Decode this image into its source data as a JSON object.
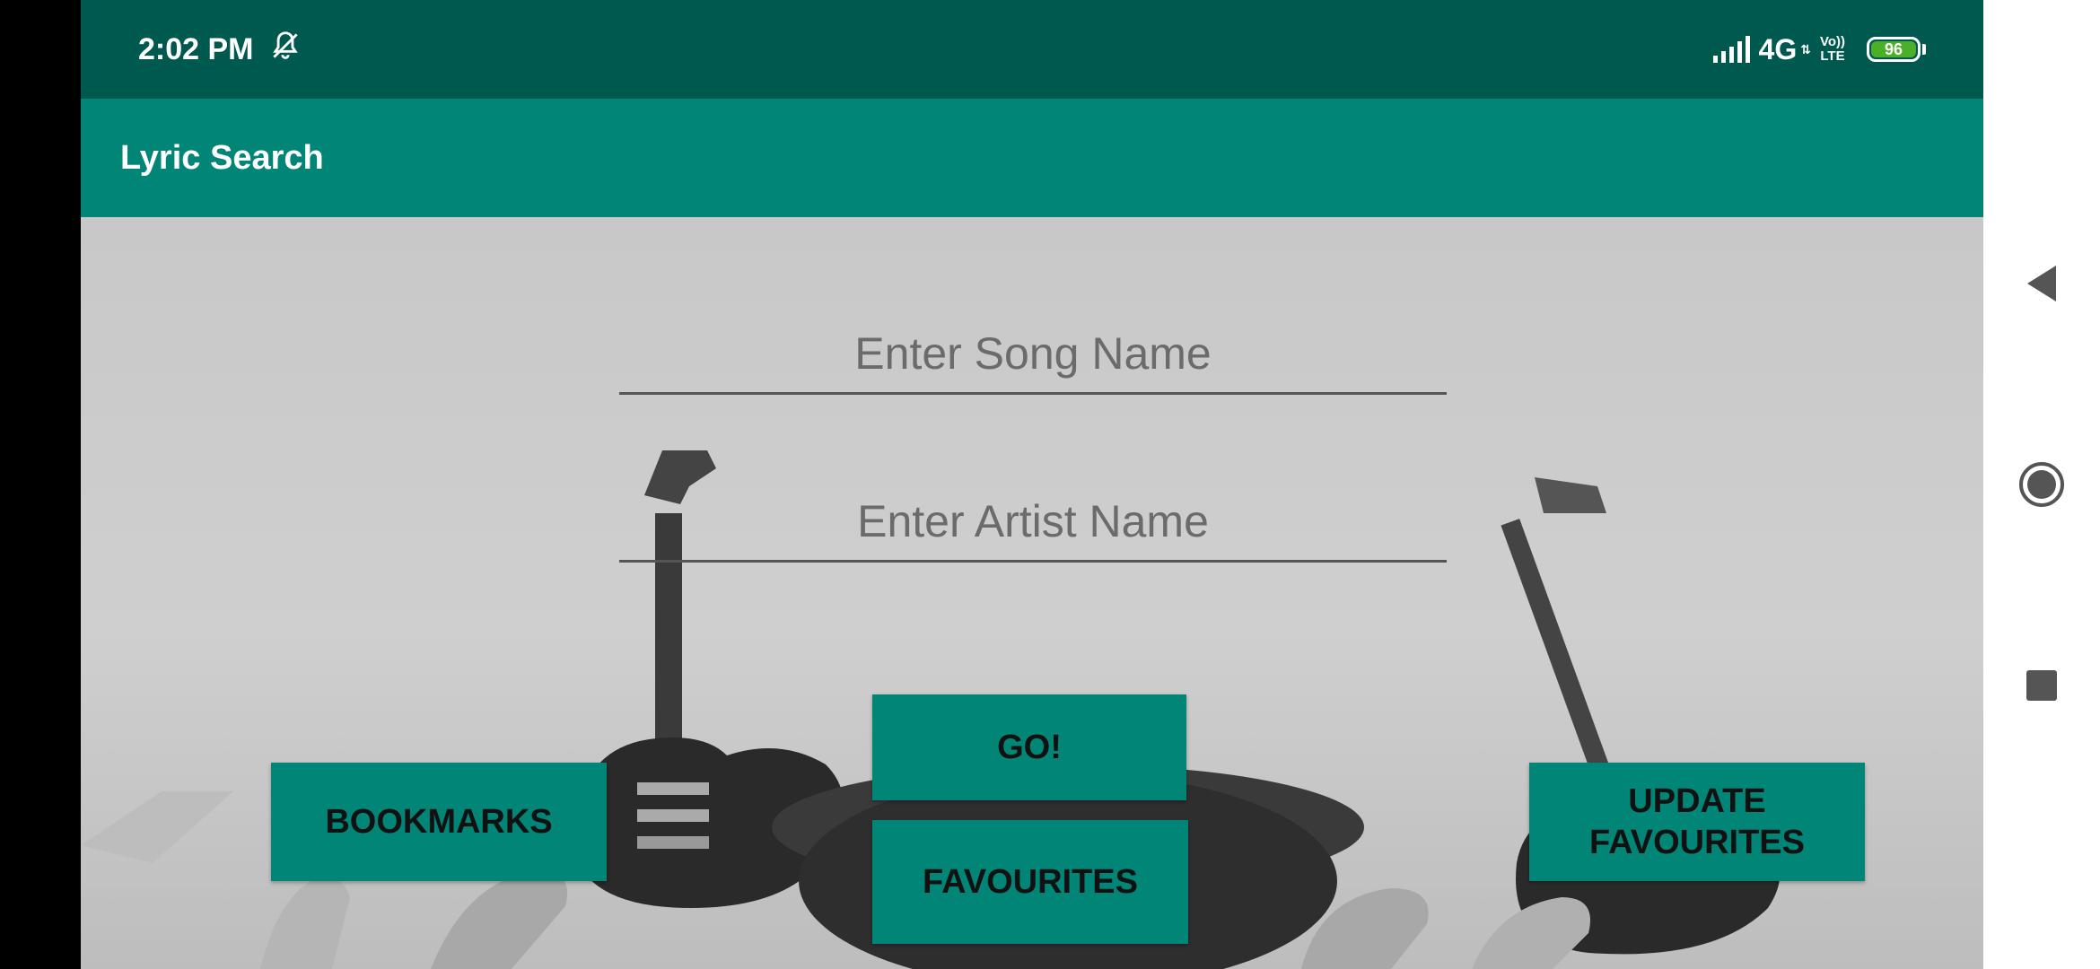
{
  "status_bar": {
    "time": "2:02 PM",
    "network": "4G",
    "volte_top": "Vo))",
    "volte_bottom": "LTE",
    "battery": "96",
    "icons": [
      "muted-bell-icon",
      "signal-icon",
      "data-arrows-icon",
      "volte-icon",
      "battery-icon"
    ]
  },
  "app_bar": {
    "title": "Lyric Search"
  },
  "form": {
    "song_placeholder": "Enter Song Name",
    "song_value": "",
    "artist_placeholder": "Enter Artist Name",
    "artist_value": ""
  },
  "buttons": {
    "go": "GO!",
    "favourites": "FAVOURITES",
    "bookmarks": "BOOKMARKS",
    "update_favourites": "UPDATE FAVOURITES"
  },
  "nav": {
    "icons": [
      "back-icon",
      "home-icon",
      "recents-icon"
    ]
  },
  "colors": {
    "status_bar": "#00594f",
    "app_bar": "#008577",
    "button": "#008577",
    "battery": "#4caf2a"
  }
}
